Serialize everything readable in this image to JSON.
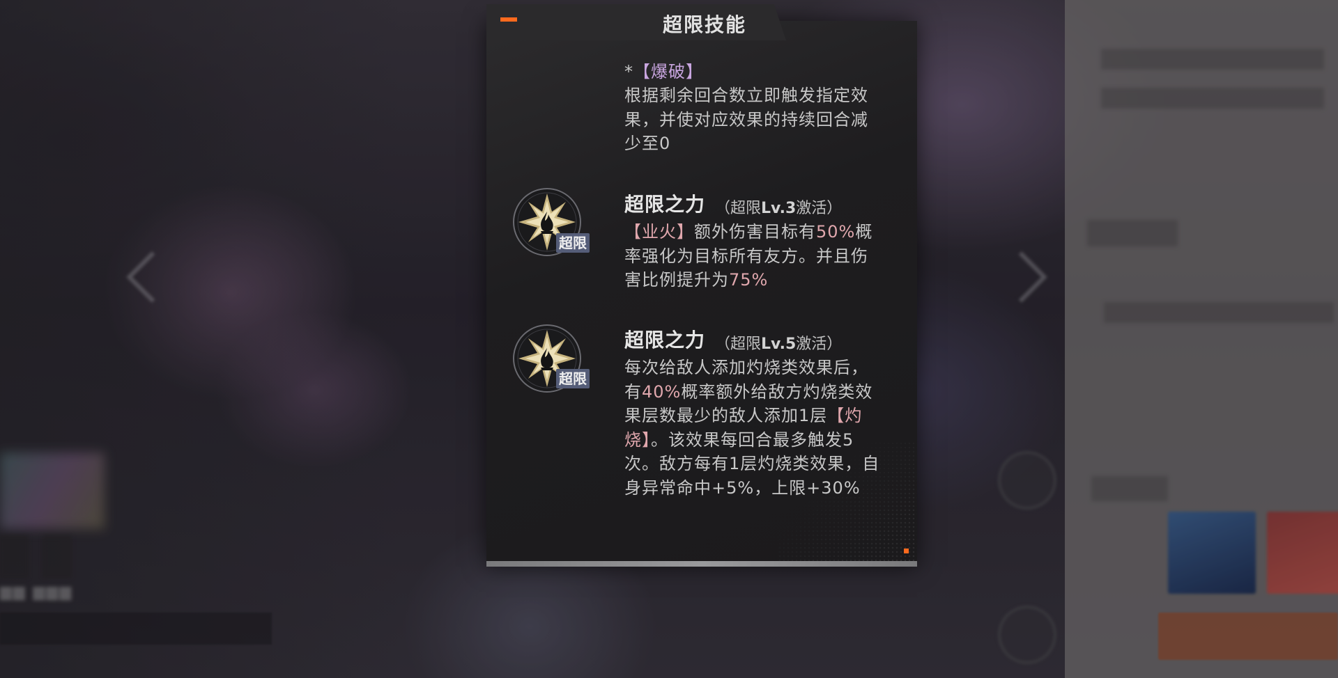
{
  "dialog": {
    "title": "超限技能",
    "accent_color": "#ff6a1e"
  },
  "top_fragment": {
    "tag_prefix": "*",
    "tag": "【爆破】",
    "desc": [
      "根据剩余回合数立即触发指定效",
      "果，并使对应效果的持续回合减",
      "少至0"
    ]
  },
  "skills": [
    {
      "icon": "overlimit-star-icon",
      "badge": "超限",
      "title": "超限之力",
      "sub_open": "（超限",
      "sub_level": "Lv.3",
      "sub_close": "激活）",
      "lines": [
        [
          {
            "t": "【业火】",
            "c": "pink"
          },
          {
            "t": "额外伤害目标有"
          },
          {
            "t": "50%",
            "c": "pink"
          },
          {
            "t": "概"
          }
        ],
        [
          {
            "t": "率强化为目标所有友方。并且伤"
          }
        ],
        [
          {
            "t": "害比例提升为"
          },
          {
            "t": "75%",
            "c": "pink"
          }
        ]
      ]
    },
    {
      "icon": "overlimit-star-icon",
      "badge": "超限",
      "title": "超限之力",
      "sub_open": "（超限",
      "sub_level": "Lv.5",
      "sub_close": "激活）",
      "lines": [
        [
          {
            "t": "每次给敌人添加灼烧类效果后，"
          }
        ],
        [
          {
            "t": "有"
          },
          {
            "t": "40%",
            "c": "pink"
          },
          {
            "t": "概率额外给敌方灼烧类效"
          }
        ],
        [
          {
            "t": "果层数最少的敌人添加1层"
          },
          {
            "t": "【灼",
            "c": "pink"
          }
        ],
        [
          {
            "t": "烧】",
            "c": "pink"
          },
          {
            "t": "。该效果每回合最多触发5"
          }
        ],
        [
          {
            "t": "次。敌方每有1层灼烧类效果，自"
          }
        ],
        [
          {
            "t": "身异常命中+5%，上限+30%"
          }
        ]
      ]
    }
  ]
}
